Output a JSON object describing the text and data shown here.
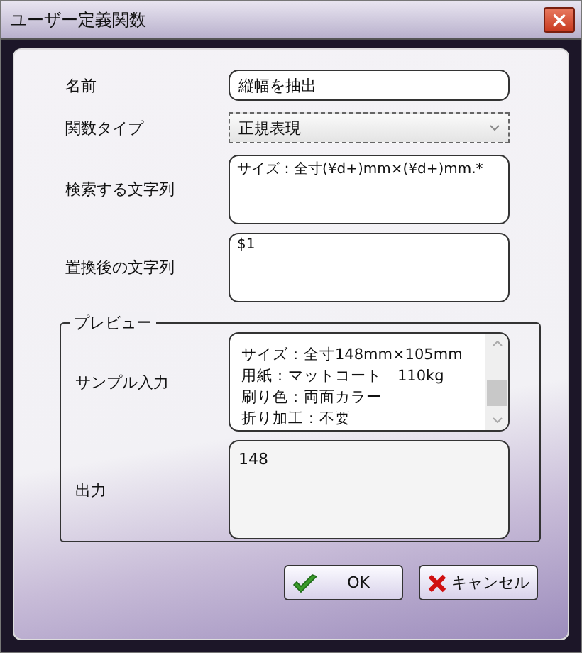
{
  "window": {
    "title": "ユーザー定義関数",
    "close": "×"
  },
  "fields": [
    {
      "label": "名前",
      "kind": "text",
      "value": "縦幅を抽出"
    },
    {
      "label": "関数タイプ",
      "kind": "select",
      "value": "正規表現"
    },
    {
      "label": "検索する文字列",
      "kind": "textarea",
      "value": "サイズ：全寸(¥d+)mm×(¥d+)mm.*"
    },
    {
      "label": "置換後の文字列",
      "kind": "textarea",
      "value": "$1"
    }
  ],
  "preview": {
    "title": "プレビュー",
    "sample_label": "サンプル入力",
    "sample_lines": [
      "サイズ：全寸148mm×105mm",
      "用紙：マットコート　110kg",
      "刷り色：両面カラー",
      "折り加工：不要"
    ],
    "output_label": "出力",
    "output": "148"
  },
  "buttons": [
    {
      "label": "OK",
      "kind": "ok"
    },
    {
      "label": "キャンセル",
      "kind": "cancel"
    }
  ]
}
